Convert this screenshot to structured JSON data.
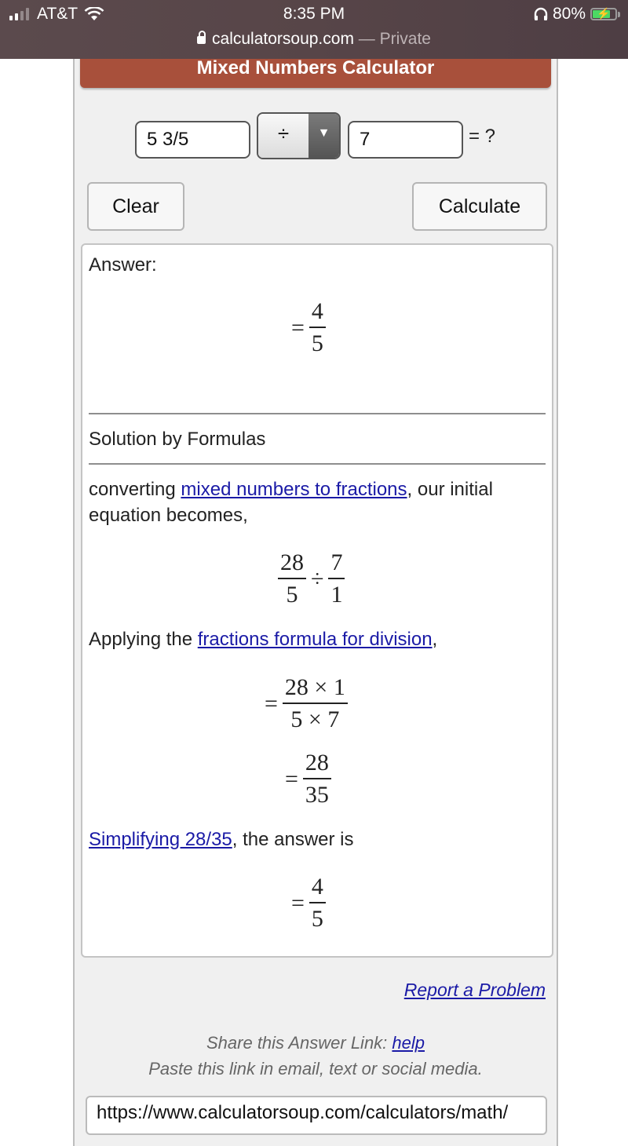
{
  "status_bar": {
    "carrier": "AT&T",
    "time": "8:35 PM",
    "battery": "80%",
    "battery_level": 0.8,
    "signal_bars_active": 2,
    "signal_bars_total": 4
  },
  "url_bar": {
    "domain": "calculatorsoup.com",
    "mode": "— Private"
  },
  "calculator": {
    "title": "Mixed Numbers Calculator",
    "input1_value": "5 3/5",
    "operator_value": "÷",
    "input2_value": "7",
    "equals_label": "= ?",
    "clear_label": "Clear",
    "calculate_label": "Calculate"
  },
  "answer": {
    "label": "Answer:",
    "result": {
      "eq": "=",
      "num": "4",
      "den": "5"
    },
    "solution_heading": "Solution by Formulas",
    "step1": {
      "text_before": "converting ",
      "link": "mixed numbers to fractions",
      "text_after": ", our initial",
      "line2": "equation becomes,"
    },
    "expr1": {
      "num1": "28",
      "den1": "5",
      "op": "÷",
      "num2": "7",
      "den2": "1"
    },
    "step2": {
      "text_before": "Applying the ",
      "link": "fractions formula for division",
      "text_after": ","
    },
    "expr2": {
      "eq": "=",
      "num": "28 × 1",
      "den": "5 × 7"
    },
    "expr3": {
      "eq": "=",
      "num": "28",
      "den": "35"
    },
    "step3": {
      "link": "Simplifying 28/35",
      "text_after": ", the answer is"
    },
    "expr4": {
      "eq": "=",
      "num": "4",
      "den": "5"
    }
  },
  "footer": {
    "report_link": "Report a Problem",
    "share_label": "Share this Answer Link: ",
    "share_help_link": "help",
    "share_hint": "Paste this link in email, text or social media.",
    "share_url": "https://www.calculatorsoup.com/calculators/math/"
  }
}
